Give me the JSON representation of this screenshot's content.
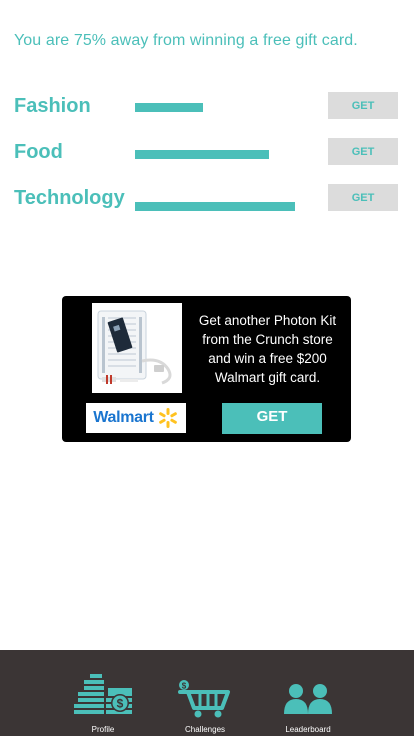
{
  "headline": "You are 75% away from winning a free gift card.",
  "categories": [
    {
      "label": "Fashion",
      "progress": 0.4,
      "button": "GET"
    },
    {
      "label": "Food",
      "progress": 0.79,
      "button": "GET"
    },
    {
      "label": "Technology",
      "progress": 0.94,
      "button": "GET"
    }
  ],
  "promo": {
    "text": "Get another Photon Kit from the Crunch store and win a free $200 Walmart gift card.",
    "image_name": "photon-kit-image",
    "logo_text": "Walmart",
    "button": "GET"
  },
  "tabbar": {
    "tabs": [
      {
        "label": "Profile",
        "icon": "profile-money-icon"
      },
      {
        "label": "Challenges",
        "icon": "cart-icon"
      },
      {
        "label": "Leaderboard",
        "icon": "people-icon"
      }
    ]
  },
  "colors": {
    "accent": "#4bbfb9",
    "button_gray": "#dcdcdc",
    "tabbar_bg": "#3b3535",
    "promo_bg": "#000000",
    "walmart_blue": "#1a75cf",
    "walmart_yellow": "#ffc220"
  }
}
